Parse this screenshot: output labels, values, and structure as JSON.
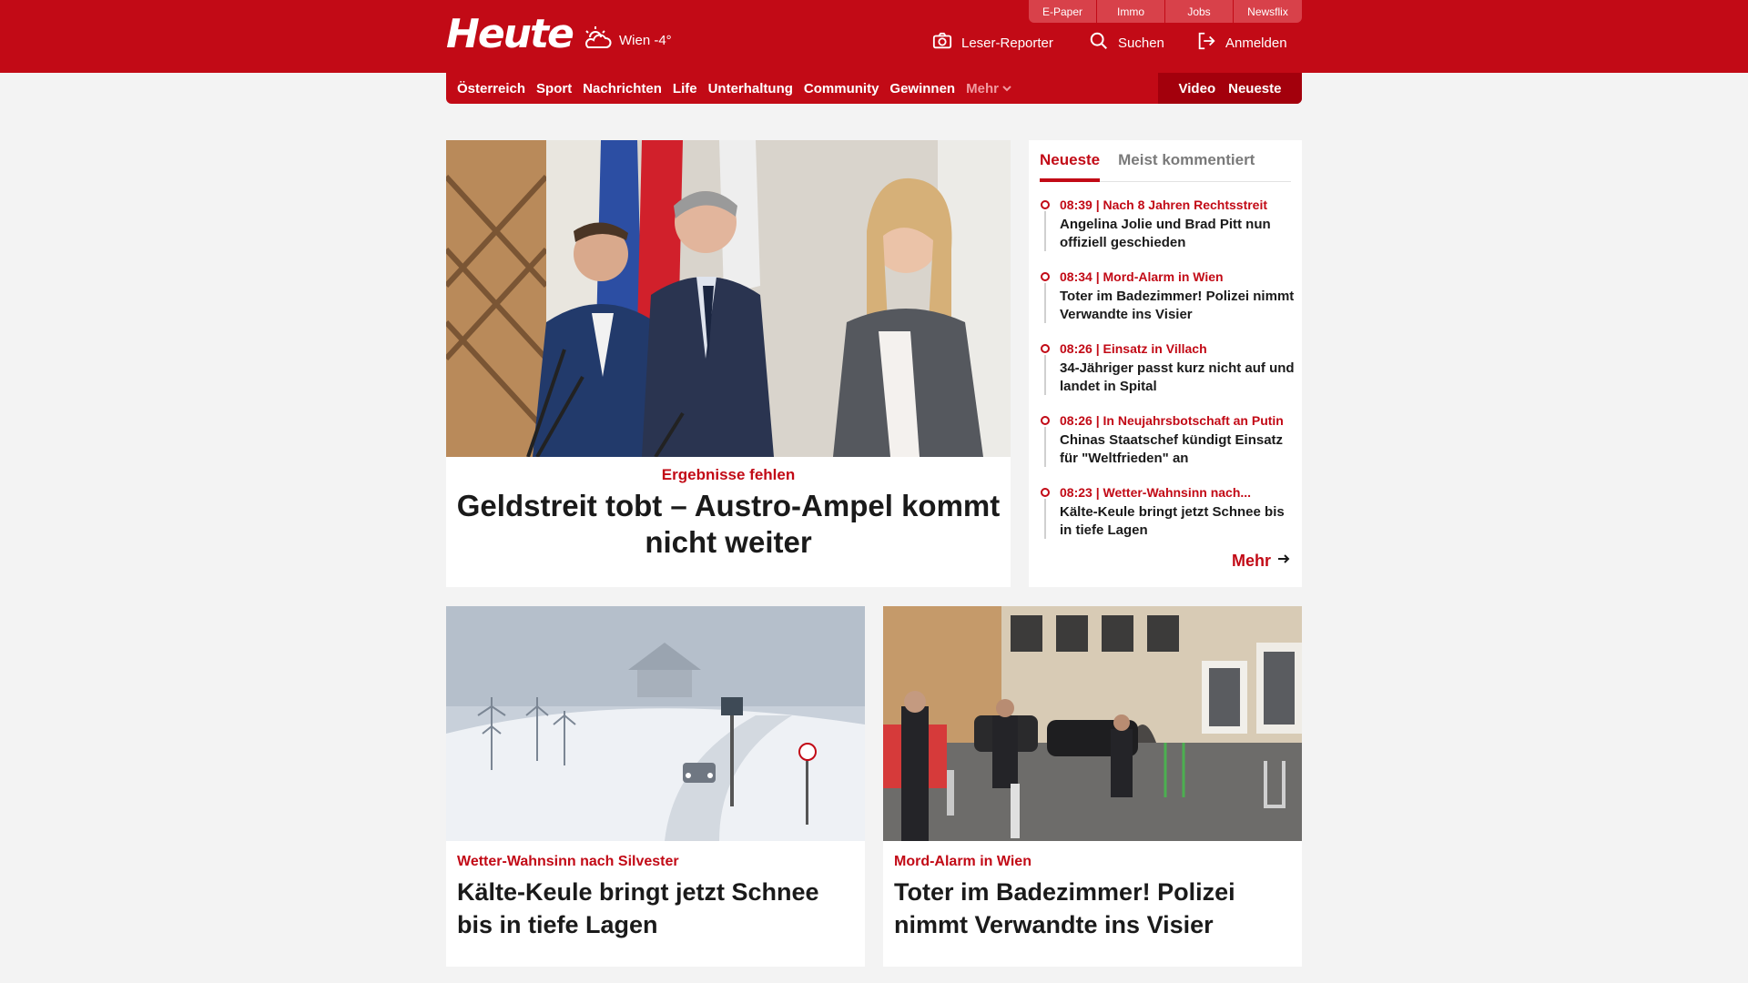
{
  "header": {
    "logo": "Heute",
    "weather": "Wien -4°",
    "top_tabs": [
      "E-Paper",
      "Immo",
      "Jobs",
      "Newsflix"
    ],
    "leser_reporter": "Leser-Reporter",
    "search": "Suchen",
    "login": "Anmelden"
  },
  "nav": {
    "items": [
      "Österreich",
      "Sport",
      "Nachrichten",
      "Life",
      "Unterhaltung",
      "Community",
      "Gewinnen"
    ],
    "more": "Mehr",
    "video": "Video",
    "latest": "Neueste"
  },
  "hero": {
    "kicker": "Ergebnisse fehlen",
    "title": "Geldstreit tobt – Austro-Ampel kommt nicht weiter"
  },
  "sidebar": {
    "tabs": [
      "Neueste",
      "Meist kommentiert"
    ],
    "items": [
      {
        "meta": "08:39 | Nach 8 Jahren Rechtsstreit",
        "title": "Angelina Jolie und Brad Pitt nun offiziell geschieden"
      },
      {
        "meta": "08:34 | Mord-Alarm in Wien",
        "title": "Toter im Badezimmer! Polizei nimmt Verwandte ins Visier"
      },
      {
        "meta": "08:26 | Einsatz in Villach",
        "title": "34-Jähriger passt kurz nicht auf und landet in Spital"
      },
      {
        "meta": "08:26 | In Neujahrsbotschaft an Putin",
        "title": "Chinas Staatschef kündigt Einsatz für \"Weltfrieden\" an"
      },
      {
        "meta": "08:23 | Wetter-Wahnsinn nach...",
        "title": "Kälte-Keule bringt jetzt Schnee bis in tiefe Lagen"
      }
    ],
    "more": "Mehr"
  },
  "cards": [
    {
      "kicker": "Wetter-Wahnsinn nach Silvester",
      "title": "Kälte-Keule bringt jetzt Schnee bis in tiefe Lagen"
    },
    {
      "kicker": "Mord-Alarm in Wien",
      "title": "Toter im Badezimmer! Polizei nimmt Verwandte ins Visier"
    }
  ],
  "colors": {
    "brand": "#c20a16",
    "background": "#f3f3f3"
  }
}
